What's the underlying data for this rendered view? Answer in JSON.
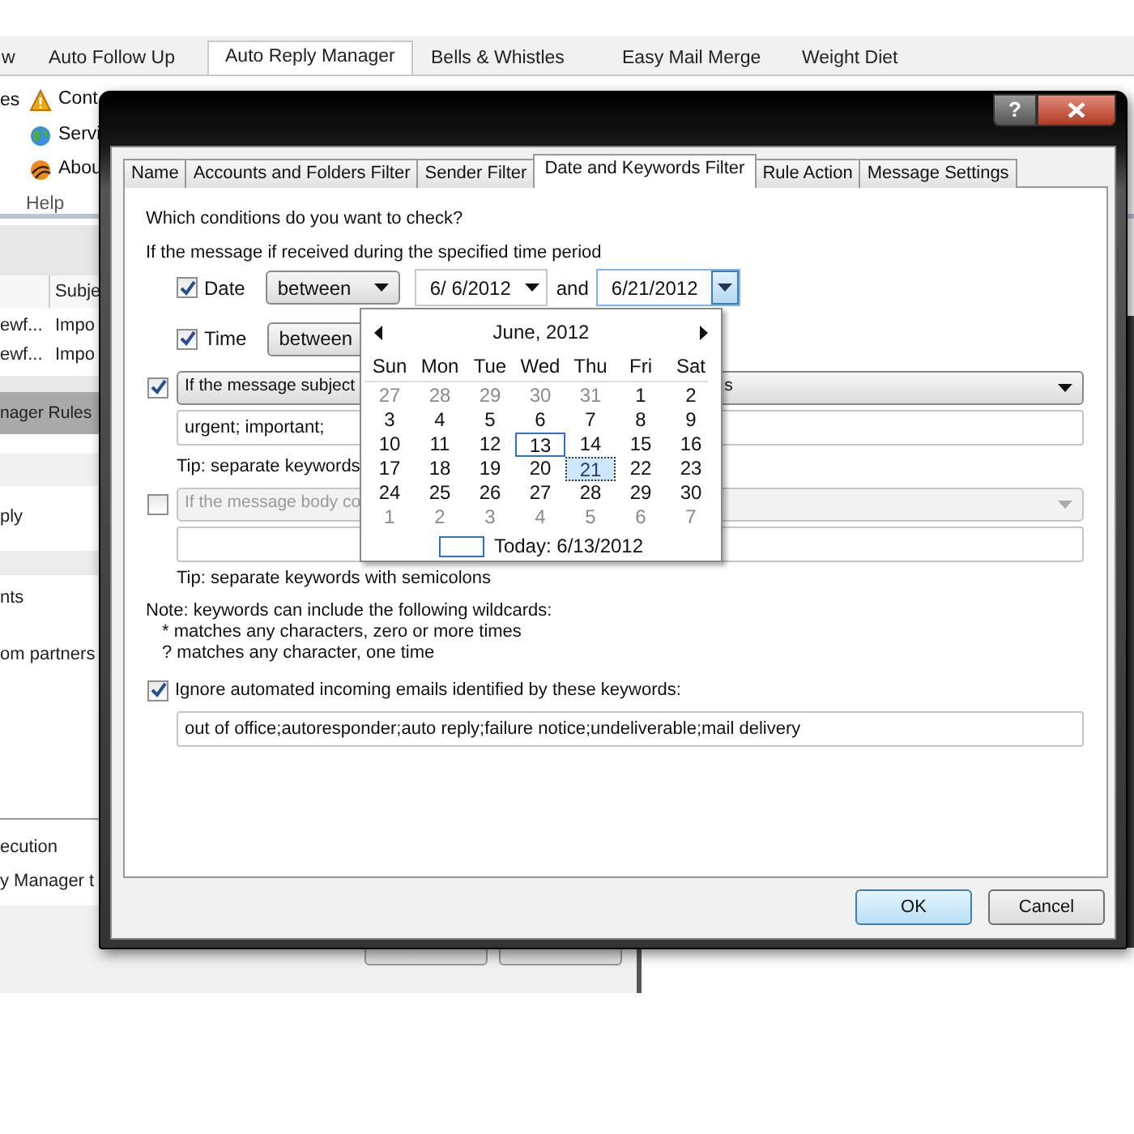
{
  "ribbon": {
    "tabs": [
      {
        "label": "w",
        "selected": false
      },
      {
        "label": "Auto Follow Up",
        "selected": false
      },
      {
        "label": "Auto Reply Manager",
        "selected": true
      },
      {
        "label": "Bells & Whistles",
        "selected": false
      },
      {
        "label": "Easy Mail Merge",
        "selected": false
      },
      {
        "label": "Weight Diet",
        "selected": false
      }
    ],
    "items": [
      {
        "kind": "plain",
        "label": "es"
      },
      {
        "kind": "warning",
        "label": "Cont"
      },
      {
        "kind": "globe",
        "label": "Servi"
      },
      {
        "kind": "about",
        "label": "Abou"
      }
    ],
    "group_label": "Help"
  },
  "background_window": {
    "columns": [
      "",
      "Subje"
    ],
    "rows": [
      [
        "ewf...",
        "Impo"
      ],
      [
        "ewf...",
        "Impo"
      ]
    ],
    "section_title": "nager Rules",
    "items": [
      "ply",
      "nts",
      "om partners"
    ],
    "footer_lines": [
      "ecution",
      "y Manager t"
    ]
  },
  "dialog": {
    "help_button": "?",
    "tabs": [
      {
        "label": "Name",
        "selected": false
      },
      {
        "label": "Accounts and Folders Filter",
        "selected": false
      },
      {
        "label": "Sender Filter",
        "selected": false
      },
      {
        "label": "Date and Keywords Filter",
        "selected": true
      },
      {
        "label": "Rule Action",
        "selected": false
      },
      {
        "label": "Message Settings",
        "selected": false
      }
    ],
    "heading": "Which conditions do you want to check?",
    "period_label": "If the message if received during the specified time period",
    "date_row": {
      "checked": true,
      "label": "Date",
      "operator": "between",
      "from": "6/ 6/2012",
      "joiner": "and",
      "to": "6/21/2012"
    },
    "time_row": {
      "checked": true,
      "label": "Time",
      "operator": "between"
    },
    "subject": {
      "checked": true,
      "condition": "If the message subject",
      "condition_tail": "s",
      "keywords": "urgent; important;",
      "tip": "Tip: separate keywords"
    },
    "body": {
      "checked": false,
      "condition": "If the message body co",
      "tip": "Tip: separate keywords with semicolons"
    },
    "note": [
      "Note: keywords can include the following wildcards:",
      "* matches any characters, zero or more times",
      "? matches any character, one time"
    ],
    "ignore": {
      "checked": true,
      "label": "Ignore automated incoming emails identified by these keywords:",
      "keywords": "out of office;autoresponder;auto reply;failure notice;undeliverable;mail delivery"
    },
    "buttons": [
      {
        "label": "OK",
        "default": true
      },
      {
        "label": "Cancel",
        "default": false
      }
    ]
  },
  "calendar": {
    "month": "June, 2012",
    "weekdays": [
      "Sun",
      "Mon",
      "Tue",
      "Wed",
      "Thu",
      "Fri",
      "Sat"
    ],
    "weeks": [
      [
        {
          "day": "27",
          "other": true,
          "today": false,
          "selected": false
        },
        {
          "day": "28",
          "other": true,
          "today": false,
          "selected": false
        },
        {
          "day": "29",
          "other": true,
          "today": false,
          "selected": false
        },
        {
          "day": "30",
          "other": true,
          "today": false,
          "selected": false
        },
        {
          "day": "31",
          "other": true,
          "today": false,
          "selected": false
        },
        {
          "day": "1",
          "other": false,
          "today": false,
          "selected": false
        },
        {
          "day": "2",
          "other": false,
          "today": false,
          "selected": false
        }
      ],
      [
        {
          "day": "3",
          "other": false,
          "today": false,
          "selected": false
        },
        {
          "day": "4",
          "other": false,
          "today": false,
          "selected": false
        },
        {
          "day": "5",
          "other": false,
          "today": false,
          "selected": false
        },
        {
          "day": "6",
          "other": false,
          "today": false,
          "selected": false
        },
        {
          "day": "7",
          "other": false,
          "today": false,
          "selected": false
        },
        {
          "day": "8",
          "other": false,
          "today": false,
          "selected": false
        },
        {
          "day": "9",
          "other": false,
          "today": false,
          "selected": false
        }
      ],
      [
        {
          "day": "10",
          "other": false,
          "today": false,
          "selected": false
        },
        {
          "day": "11",
          "other": false,
          "today": false,
          "selected": false
        },
        {
          "day": "12",
          "other": false,
          "today": false,
          "selected": false
        },
        {
          "day": "13",
          "other": false,
          "today": true,
          "selected": false
        },
        {
          "day": "14",
          "other": false,
          "today": false,
          "selected": false
        },
        {
          "day": "15",
          "other": false,
          "today": false,
          "selected": false
        },
        {
          "day": "16",
          "other": false,
          "today": false,
          "selected": false
        }
      ],
      [
        {
          "day": "17",
          "other": false,
          "today": false,
          "selected": false
        },
        {
          "day": "18",
          "other": false,
          "today": false,
          "selected": false
        },
        {
          "day": "19",
          "other": false,
          "today": false,
          "selected": false
        },
        {
          "day": "20",
          "other": false,
          "today": false,
          "selected": false
        },
        {
          "day": "21",
          "other": false,
          "today": false,
          "selected": true
        },
        {
          "day": "22",
          "other": false,
          "today": false,
          "selected": false
        },
        {
          "day": "23",
          "other": false,
          "today": false,
          "selected": false
        }
      ],
      [
        {
          "day": "24",
          "other": false,
          "today": false,
          "selected": false
        },
        {
          "day": "25",
          "other": false,
          "today": false,
          "selected": false
        },
        {
          "day": "26",
          "other": false,
          "today": false,
          "selected": false
        },
        {
          "day": "27",
          "other": false,
          "today": false,
          "selected": false
        },
        {
          "day": "28",
          "other": false,
          "today": false,
          "selected": false
        },
        {
          "day": "29",
          "other": false,
          "today": false,
          "selected": false
        },
        {
          "day": "30",
          "other": false,
          "today": false,
          "selected": false
        }
      ],
      [
        {
          "day": "1",
          "other": true,
          "today": false,
          "selected": false
        },
        {
          "day": "2",
          "other": true,
          "today": false,
          "selected": false
        },
        {
          "day": "3",
          "other": true,
          "today": false,
          "selected": false
        },
        {
          "day": "4",
          "other": true,
          "today": false,
          "selected": false
        },
        {
          "day": "5",
          "other": true,
          "today": false,
          "selected": false
        },
        {
          "day": "6",
          "other": true,
          "today": false,
          "selected": false
        },
        {
          "day": "7",
          "other": true,
          "today": false,
          "selected": false
        }
      ]
    ],
    "today_label": "Today: 6/13/2012"
  }
}
